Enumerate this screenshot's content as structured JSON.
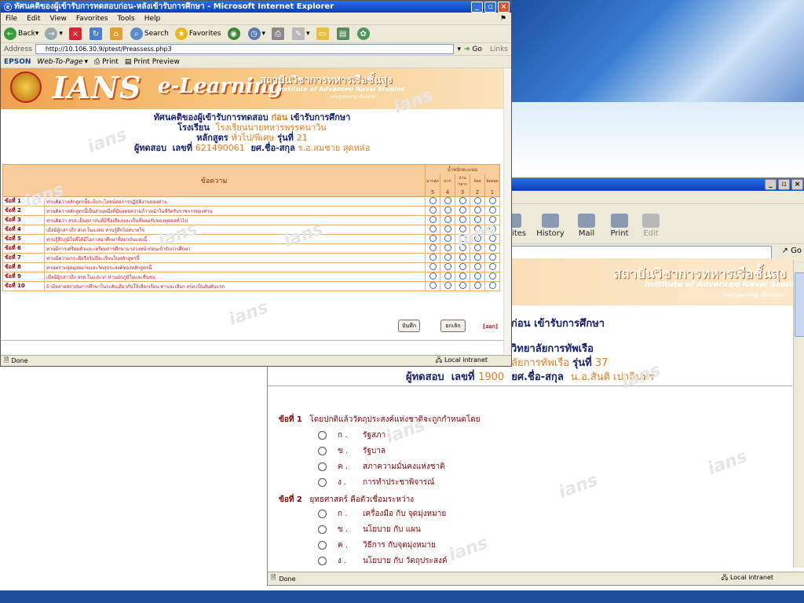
{
  "front": {
    "title": "ทัศนคติของผู้เข้ารับการทดสอบก่อน-หลังเข้ารับการศึกษา - Microsoft Internet Explorer",
    "menu": [
      "File",
      "Edit",
      "View",
      "Favorites",
      "Tools",
      "Help"
    ],
    "toolbar": {
      "back": "Back",
      "search": "Search",
      "favorites": "Favorites"
    },
    "address_label": "Address",
    "address": "http://10.106.30.9/ptest/Preassess.php3",
    "go": "Go",
    "links": "Links",
    "epson": "EPSON",
    "web_to_page": "Web-To-Page",
    "print": "Print",
    "print_preview": "Print Preview",
    "banner": {
      "ians": "IANS",
      "elearning": "e-Learning",
      "inst_th": "สถาบันวิชาการทหารเรือชั้นสูง",
      "inst_en": "Institute of Advanced Naval Studies",
      "division": "wargaming division"
    },
    "header": {
      "line1_a": "ทัศนคติของผู้เข้ารับการทดสอบ",
      "line1_b": "ก่อน",
      "line1_c": "เข้ารับการศึกษา",
      "school_label": "โรงเรียน",
      "school_value": "โรงเรียนนายทหารพรรคนาวิน",
      "course_label": "หลักสูตร",
      "course_value": "ทั่วไป/พิเศษ",
      "batch_label": "รุ่นที่",
      "batch_value": "21",
      "tester_label": "ผู้ทดสอบ",
      "id_label": "เลขที่",
      "id_value": "621490061",
      "rank_label": "ยศ.ชื่อ-สกุล",
      "rank_value": "ร.อ.สมชาย สุดหล่อ"
    },
    "table": {
      "col_statement": "ข้อความ",
      "col_weight": "น้ำหนักคะแนน",
      "scale": [
        {
          "label": "มากสุด",
          "score": "5"
        },
        {
          "label": "มาก",
          "score": "4"
        },
        {
          "label": "ปานกลาง",
          "score": "3"
        },
        {
          "label": "น้อย",
          "score": "2"
        },
        {
          "label": "น้อยสุด",
          "score": "1"
        }
      ],
      "rows": [
        {
          "no": "ข้อที่ 1",
          "text": "ท่านคิดว่าหลักสูตรนี้จะมีประโยชน์ต่อการปฏิบัติงานของท่าน"
        },
        {
          "no": "ข้อที่ 2",
          "text": "ท่านคิดว่าหลักสูตรนี้เป็นส่วนหนึ่งที่มีผลต่อความก้าวหน้าในชีวิตรับราชการของท่าน"
        },
        {
          "no": "ข้อที่ 3",
          "text": "ท่านคิดว่า สรส.เป็นสถาบันที่มีชื่อเสียงและเป็นที่ยอมรับของบุคคลทั่วไป"
        },
        {
          "no": "ข้อที่ 4",
          "text": "เมื่อมีผู้กล่าวถึง สรส.ในแง่ลบ ท่านรู้สึกไม่สบายใจ"
        },
        {
          "no": "ข้อที่ 5",
          "text": "ท่านรู้สึกภูมิใจที่ได้มีโอกาสมาศึกษาที่สถาบันแห่งนี้"
        },
        {
          "no": "ข้อที่ 6",
          "text": "ท่านมีการเตรียมตัวและเตรียมการศึกษามาล่วงหน้าก่อนเข้ารับการศึกษา"
        },
        {
          "no": "ข้อที่ 7",
          "text": "ท่านมีความกระตือรือร้นที่จะเรียนในหลักสูตรนี้"
        },
        {
          "no": "ข้อที่ 8",
          "text": "ท่านทราบจุดมุ่งหมายและวัตถุประสงค์ของหลักสูตรนี้"
        },
        {
          "no": "ข้อที่ 9",
          "text": "เมื่อมีผู้กล่าวถึง สรส.ในแง่บวก ท่านมักภูมิใจและชื่นชม"
        },
        {
          "no": "ข้อที่ 10",
          "text": "ถ้ามีหลายสถาบันการศึกษาในระดับเดียวกันให้เลือกเรียน ท่านจะเลือก สรส.เป็นอันดับแรก"
        }
      ]
    },
    "buttons": {
      "save": "บันทึก",
      "cancel": "ยกเลิก",
      "logout": "[ออก]"
    },
    "status": {
      "done": "Done",
      "zone": "Local intranet"
    }
  },
  "back": {
    "title": "orer",
    "toolbar": [
      "vorites",
      "History",
      "Mail",
      "Print",
      "Edit"
    ],
    "go": "Go",
    "banner": {
      "learning": "earning",
      "inst_th": "สถาบันวิชาการทหารเรือชั้นสูง",
      "inst_en": "Institute of Advanced Naval Studies",
      "division": "wargaming division"
    },
    "header": {
      "line1": "ก่อน เข้ารับการศึกษา",
      "school": "วิทยาลัยการทัพเรือ",
      "course_a": "ลัยการทัพเรือ",
      "batch_label": "รุ่นที่",
      "batch_value": "37",
      "tester_label": "ผู้ทดสอบ",
      "id_label": "เลขที่",
      "id_value": "1900",
      "rank_label": "ยศ.ชื่อ-สกุล",
      "rank_value": "น.อ.สันติ เปาอินทร"
    },
    "questions": [
      {
        "no": "ข้อที่ 1",
        "text": "โดยปกติแล้ววัตถุประสงค์แห่งชาติจะถูกกำหนดโดย",
        "options": [
          {
            "key": "ก .",
            "text": "รัฐสภา"
          },
          {
            "key": "ข .",
            "text": "รัฐบาล"
          },
          {
            "key": "ค .",
            "text": "สภาความมั่นคงแห่งชาติ"
          },
          {
            "key": "ง .",
            "text": "การทำประชาพิจารณ์"
          }
        ]
      },
      {
        "no": "ข้อที่ 2",
        "text": "ยุทธศาสตร์ คือตัวเชื่อมระหว่าง",
        "options": [
          {
            "key": "ก .",
            "text": "เครื่องมือ กับ จุดมุ่งหมาย"
          },
          {
            "key": "ข .",
            "text": "นโยบาย กับ แผน"
          },
          {
            "key": "ค .",
            "text": "วิธีการ กับจุดมุ่งหมาย"
          },
          {
            "key": "ง .",
            "text": "นโยบาย กับ วัตถุประสงค์"
          }
        ]
      }
    ],
    "status": {
      "done": "Done",
      "zone": "Local intranet"
    }
  },
  "watermark": "ians"
}
